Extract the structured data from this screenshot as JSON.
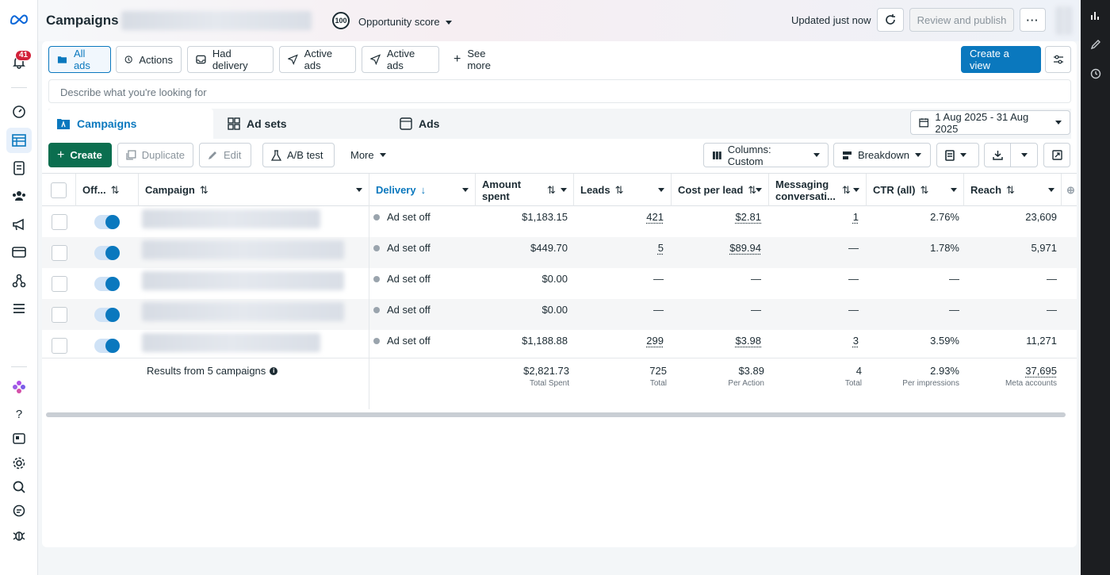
{
  "header": {
    "title": "Campaigns",
    "score_value": "100",
    "score_label": "Opportunity score",
    "updated": "Updated just now",
    "review_publish": "Review and publish",
    "more_icon": "more-horizontal-icon"
  },
  "leftnav": {
    "notifications_count": "41",
    "icons": [
      "meta-logo-icon",
      "bell-icon",
      "dashboard-icon",
      "table-icon",
      "catalog-icon",
      "audiences-icon",
      "megaphone-icon",
      "billing-card-icon",
      "pixels-icon",
      "menu-icon",
      "flower-icon",
      "help-icon",
      "news-icon",
      "gear-icon",
      "search-icon",
      "feedback-icon",
      "bug-icon"
    ]
  },
  "filters": {
    "items": [
      {
        "label": "All ads",
        "icon": "folder-icon"
      },
      {
        "label": "Actions",
        "icon": "actions-icon"
      },
      {
        "label": "Had delivery",
        "icon": "inbox-icon"
      },
      {
        "label": "Active ads",
        "icon": "send-icon"
      },
      {
        "label": "Active ads",
        "icon": "send-icon"
      },
      {
        "label": "See more",
        "icon": "plus-icon"
      }
    ],
    "create_view": "Create a view",
    "search_placeholder": "Describe what you're looking for"
  },
  "tabs": {
    "campaigns": "Campaigns",
    "ad_sets": "Ad sets",
    "ads": "Ads",
    "date_range": "1 Aug 2025 - 31 Aug 2025"
  },
  "toolbar": {
    "create": "Create",
    "duplicate": "Duplicate",
    "edit": "Edit",
    "ab_test": "A/B test",
    "more": "More",
    "columns": "Columns: Custom",
    "breakdown": "Breakdown"
  },
  "table": {
    "columns": {
      "off_on": "Off...",
      "campaign": "Campaign",
      "delivery": "Delivery",
      "amount_spent": "Amount spent",
      "leads": "Leads",
      "cost_per_lead": "Cost per lead",
      "messaging": "Messaging conversati...",
      "ctr": "CTR (all)",
      "reach": "Reach"
    },
    "rows": [
      {
        "delivery": "Ad set off",
        "amount": "$1,183.15",
        "leads": "421",
        "cpl": "$2.81",
        "messaging": "1",
        "ctr": "2.76%",
        "reach": "23,609"
      },
      {
        "delivery": "Ad set off",
        "amount": "$449.70",
        "leads": "5",
        "cpl": "$89.94",
        "messaging": "—",
        "ctr": "1.78%",
        "reach": "5,971"
      },
      {
        "delivery": "Ad set off",
        "amount": "$0.00",
        "leads": "—",
        "cpl": "—",
        "messaging": "—",
        "ctr": "—",
        "reach": "—"
      },
      {
        "delivery": "Ad set off",
        "amount": "$0.00",
        "leads": "—",
        "cpl": "—",
        "messaging": "—",
        "ctr": "—",
        "reach": "—"
      },
      {
        "delivery": "Ad set off",
        "amount": "$1,188.88",
        "leads": "299",
        "cpl": "$3.98",
        "messaging": "3",
        "ctr": "3.59%",
        "reach": "11,271"
      }
    ],
    "totals": {
      "label": "Results from 5 campaigns",
      "amount": "$2,821.73",
      "amount_sub": "Total Spent",
      "leads": "725",
      "leads_sub": "Total",
      "cpl": "$3.89",
      "cpl_sub": "Per Action",
      "messaging": "4",
      "messaging_sub": "Total",
      "ctr": "2.93%",
      "ctr_sub": "Per impressions",
      "reach": "37,695",
      "reach_sub": "Meta accounts"
    }
  }
}
